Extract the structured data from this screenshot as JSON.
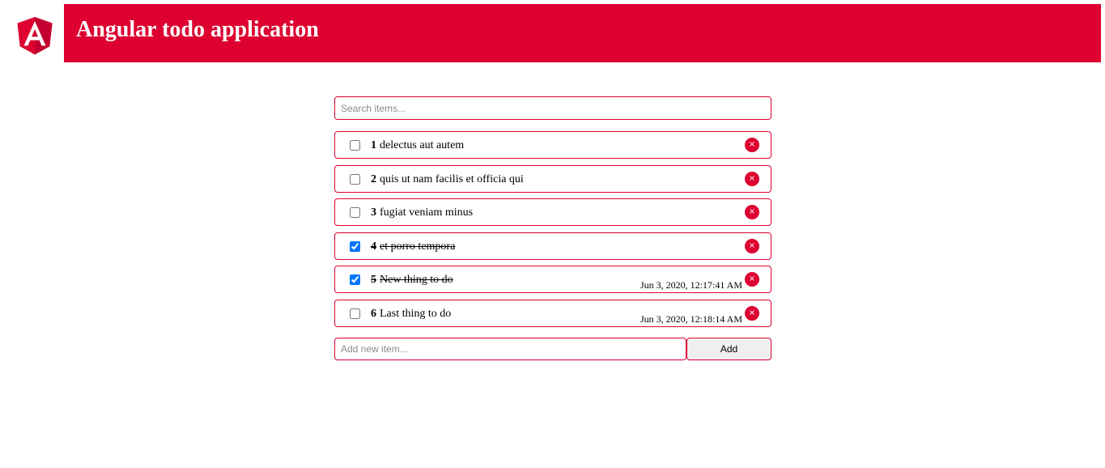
{
  "header": {
    "title": "Angular todo application",
    "logo_icon": "angular-logo-icon",
    "brand_color": "#dd0031"
  },
  "search": {
    "placeholder": "Search items...",
    "value": ""
  },
  "todos": [
    {
      "id": "1",
      "title": "delectus aut autem",
      "completed": false,
      "date": ""
    },
    {
      "id": "2",
      "title": "quis ut nam facilis et officia qui",
      "completed": false,
      "date": ""
    },
    {
      "id": "3",
      "title": "fugiat veniam minus",
      "completed": false,
      "date": ""
    },
    {
      "id": "4",
      "title": "et porro tempora",
      "completed": true,
      "date": ""
    },
    {
      "id": "5",
      "title": "New thing to do",
      "completed": true,
      "date": "Jun 3, 2020, 12:17:41 AM"
    },
    {
      "id": "6",
      "title": "Last thing to do",
      "completed": false,
      "date": "Jun 3, 2020, 12:18:14 AM"
    }
  ],
  "delete_icon": "close-icon",
  "delete_glyph": "×",
  "new_item": {
    "placeholder": "Add new item...",
    "value": ""
  },
  "add_button_label": "Add"
}
